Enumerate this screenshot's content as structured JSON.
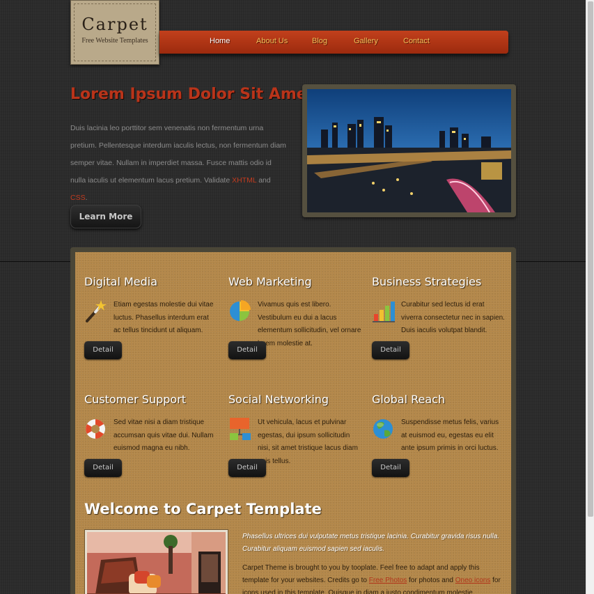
{
  "logo": {
    "title": "Carpet",
    "subtitle": "Free Website Templates"
  },
  "nav": [
    {
      "label": "Home",
      "active": true
    },
    {
      "label": "About Us",
      "active": false
    },
    {
      "label": "Blog",
      "active": false
    },
    {
      "label": "Gallery",
      "active": false
    },
    {
      "label": "Contact",
      "active": false
    }
  ],
  "hero": {
    "title": "Lorem Ipsum Dolor Sit Amet",
    "text_before": "Duis lacinia leo porttitor sem venenatis non fermentum urna pretium. Pellentesque interdum iaculis lectus, non fermentum diam semper vitae. Nullam in imperdiet massa. Fusce mattis odio id nulla iaculis ut elementum lacus pretium. Validate",
    "link_xhtml": "XHTML",
    "text_and": "and",
    "link_css": "CSS",
    "text_end": ".",
    "button": "Learn More",
    "image": "city-night-skyline"
  },
  "services": [
    {
      "title": "Digital Media",
      "icon": "magic-wand-icon",
      "text": "Etiam egestas molestie dui vitae luctus. Phasellus interdum erat ac tellus tincidunt ut aliquam.",
      "button": "Detail"
    },
    {
      "title": "Web Marketing",
      "icon": "pie-chart-icon",
      "text": "Vivamus quis est libero. Vestibulum eu dui a lacus elementum sollicitudin, vel ornare lorem molestie at.",
      "button": "Detail"
    },
    {
      "title": "Business Strategies",
      "icon": "bar-chart-icon",
      "text": "Curabitur sed lectus id erat viverra consectetur nec in sapien. Duis iaculis volutpat blandit.",
      "button": "Detail"
    },
    {
      "title": "Customer Support",
      "icon": "lifebuoy-icon",
      "text": "Sed vitae nisi a diam tristique accumsan quis vitae dui. Nullam euismod magna eu nibh.",
      "button": "Detail"
    },
    {
      "title": "Social Networking",
      "icon": "network-icon",
      "text": "Ut vehicula, lacus et pulvinar egestas, dui ipsum sollicitudin nisi, sit amet tristique lacus diam quis tellus.",
      "button": "Detail"
    },
    {
      "title": "Global Reach",
      "icon": "globe-icon",
      "text": "Suspendisse metus felis, varius at euismod eu, egestas eu elit ante ipsum primis in orci luctus.",
      "button": "Detail"
    }
  ],
  "welcome": {
    "title": "Welcome to Carpet Template",
    "intro": "Phasellus ultrices dui vulputate metus tristique lacinia. Curabitur gravida risus nulla. Curabitur aliquam euismod sapien sed iaculis.",
    "body_1": "Carpet Theme is brought to you by tooplate. Feel free to adapt and apply this template for your websites. Credits go to",
    "link_photos": "Free Photos",
    "body_2": "for photos and",
    "link_icons": "Oneo icons",
    "body_3": "for icons used in this template. Quisque in diam a justo condimentum molestie. Vivamus a velit. Vivamus leo velit, convallis id",
    "image": "interior-room-photo"
  }
}
